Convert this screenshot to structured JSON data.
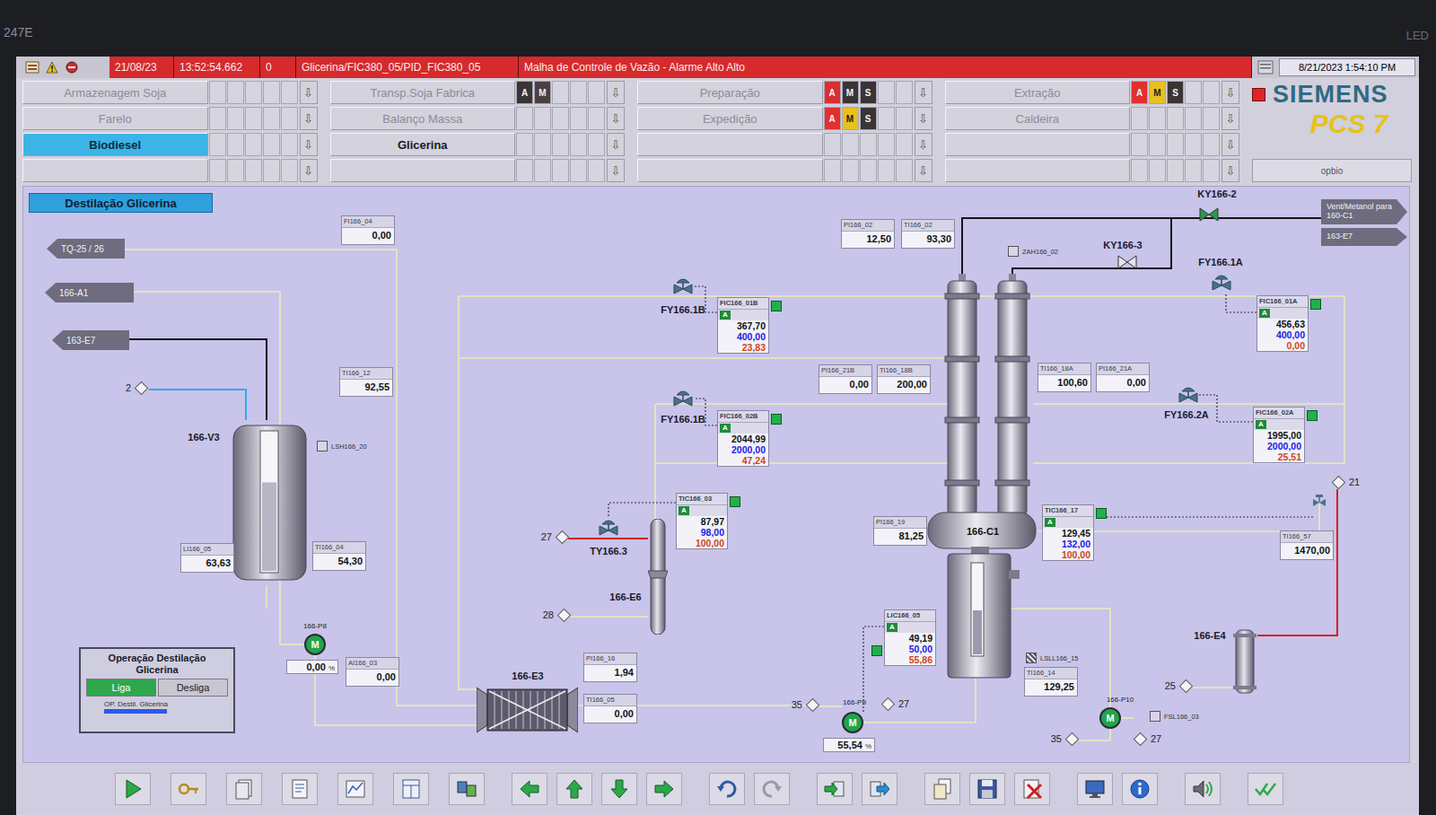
{
  "bezel": {
    "left_label": "247E",
    "right_label": "LED"
  },
  "alarm": {
    "date": "21/08/23",
    "time": "13:52:54.662",
    "count": "0",
    "source": "Glicerina/FIC380_05/PID_FIC380_05",
    "message": "Malha de Controle de Vazão - Alarme Alto Alto",
    "clock": "8/21/2023 1:54:10 PM"
  },
  "nav": {
    "arrow": "⇩",
    "rows": [
      [
        {
          "label": "Armazenagem Soja",
          "selected": false,
          "dimmed": true,
          "flags": []
        },
        {
          "label": "Transp.Soja Fabrica",
          "selected": false,
          "dimmed": true,
          "flags": [
            {
              "letter": "A",
              "color": "#3a3434"
            },
            {
              "letter": "M",
              "color": "#4a4040"
            }
          ]
        },
        {
          "label": "Preparação",
          "selected": false,
          "dimmed": true,
          "flags": [
            {
              "letter": "A",
              "color": "#d83030"
            },
            {
              "letter": "M",
              "color": "#3a3434"
            },
            {
              "letter": "S",
              "color": "#3a3434"
            }
          ]
        },
        {
          "label": "Extração",
          "selected": false,
          "dimmed": true,
          "flags": [
            {
              "letter": "A",
              "color": "#e03030"
            },
            {
              "letter": "M",
              "color": "#e8c020"
            },
            {
              "letter": "S",
              "color": "#3a3434"
            }
          ]
        }
      ],
      [
        {
          "label": "Farelo",
          "selected": false,
          "dimmed": true,
          "flags": []
        },
        {
          "label": "Balanço Massa",
          "selected": false,
          "dimmed": true,
          "flags": []
        },
        {
          "label": "Expedição",
          "selected": false,
          "dimmed": true,
          "flags": [
            {
              "letter": "A",
              "color": "#e03030"
            },
            {
              "letter": "M",
              "color": "#e8c020"
            },
            {
              "letter": "S",
              "color": "#3a3434"
            }
          ]
        },
        {
          "label": "Caldeira",
          "selected": false,
          "dimmed": true,
          "flags": []
        }
      ],
      [
        {
          "label": "Biodiesel",
          "selected": true,
          "dimmed": false,
          "flags": []
        },
        {
          "label": "Glicerina",
          "selected": false,
          "dimmed": false,
          "flags": []
        },
        {
          "label": "",
          "selected": false,
          "dimmed": false,
          "flags": []
        },
        {
          "label": "",
          "selected": false,
          "dimmed": false,
          "flags": []
        }
      ],
      [
        {
          "label": "",
          "selected": false,
          "dimmed": false,
          "flags": []
        },
        {
          "label": "",
          "selected": false,
          "dimmed": false,
          "flags": []
        },
        {
          "label": "",
          "selected": false,
          "dimmed": false,
          "flags": []
        },
        {
          "label": "",
          "selected": false,
          "dimmed": false,
          "flags": []
        }
      ]
    ]
  },
  "alarm_indicator": {
    "active": true,
    "color": "#e02424"
  },
  "logo": {
    "brand": "SIEMENS",
    "product": "PCS 7"
  },
  "user": "opbio",
  "diagram": {
    "title": "Destilação Glicerina",
    "connectors": [
      {
        "label": "TQ-25 / 26",
        "kind": "left"
      },
      {
        "label": "166-A1",
        "kind": "left"
      },
      {
        "label": "163-E7",
        "kind": "left"
      },
      {
        "label": "Vent/Metanol para 160-C1",
        "kind": "right"
      },
      {
        "label": "163-E7",
        "kind": "right"
      }
    ],
    "indicators": [
      {
        "tag": "FI166_04",
        "value": "0,00"
      },
      {
        "tag": "TI166_12",
        "value": "92,55"
      },
      {
        "tag": "LI166_05",
        "value": "63,63"
      },
      {
        "tag": "TI166_04",
        "value": "54,30"
      },
      {
        "tag": "AI166_03",
        "value": "0,00"
      },
      {
        "tag": "PI166_16",
        "value": "1,94"
      },
      {
        "tag": "TI166_05",
        "value": "0,00"
      },
      {
        "tag": "PI166_21B",
        "value": "0,00"
      },
      {
        "tag": "TI166_18B",
        "value": "200,00"
      },
      {
        "tag": "PI166_02",
        "value": "12,50"
      },
      {
        "tag": "TI166_02",
        "value": "93,30"
      },
      {
        "tag": "TI166_18A",
        "value": "100,60"
      },
      {
        "tag": "PI166_21A",
        "value": "0,00"
      },
      {
        "tag": "PI166_19",
        "value": "81,25"
      },
      {
        "tag": "TI166_57",
        "value": "1470,00"
      },
      {
        "tag": "TI166_14",
        "value": "129,25"
      }
    ],
    "controllers": [
      {
        "tag": "FIC166_01B",
        "mode": "A",
        "pv": "367,70",
        "sp": "400,00",
        "out": "23,83",
        "ok": true
      },
      {
        "tag": "FIC166_02B",
        "mode": "A",
        "pv": "2044,99",
        "sp": "2000,00",
        "out": "47,24",
        "ok": true
      },
      {
        "tag": "TIC166_03",
        "mode": "A",
        "pv": "87,97",
        "sp": "98,00",
        "out": "100,00",
        "ok": true
      },
      {
        "tag": "TIC166_17",
        "mode": "A",
        "pv": "129,45",
        "sp": "132,00",
        "out": "100,00",
        "ok": true
      },
      {
        "tag": "LIC166_05",
        "mode": "A",
        "pv": "49,19",
        "sp": "50,00",
        "out": "55,86",
        "ok": true
      },
      {
        "tag": "FIC166_01A",
        "mode": "A",
        "pv": "456,63",
        "sp": "400,00",
        "out": "0,00",
        "ok": true
      },
      {
        "tag": "FIC166_02A",
        "mode": "A",
        "pv": "1995,00",
        "sp": "2000,00",
        "out": "25,51",
        "ok": true
      }
    ],
    "valves": [
      {
        "tag": "FY166.1B",
        "kind": "control"
      },
      {
        "tag": "FY166.1B",
        "kind": "control"
      },
      {
        "tag": "TY166.3",
        "kind": "control"
      },
      {
        "tag": "FY166.1A",
        "kind": "control"
      },
      {
        "tag": "FY166.2A",
        "kind": "control"
      },
      {
        "tag": "KY166-2",
        "kind": "open"
      },
      {
        "tag": "KY166-3",
        "kind": "closed"
      }
    ],
    "equipment": [
      {
        "tag": "166-V3",
        "kind": "tank",
        "level": 0.64
      },
      {
        "tag": "166-E6",
        "kind": "shell"
      },
      {
        "tag": "166-E3",
        "kind": "plate"
      },
      {
        "tag": "166-C1",
        "kind": "column",
        "level": 0.49
      },
      {
        "tag": "166-E4",
        "kind": "cooler"
      }
    ],
    "pumps": [
      {
        "tag": "166-P8",
        "glyph": "M",
        "running": true
      },
      {
        "tag": "166-P9",
        "glyph": "M",
        "running": true
      },
      {
        "tag": "166-P10",
        "glyph": "M",
        "running": true
      }
    ],
    "points": [
      {
        "label": "2"
      },
      {
        "label": "27"
      },
      {
        "label": "28"
      },
      {
        "label": "35"
      },
      {
        "label": "27"
      },
      {
        "label": "35"
      },
      {
        "label": "27"
      },
      {
        "label": "25"
      },
      {
        "label": "21"
      }
    ],
    "switches": [
      {
        "tag": "LSH166_20",
        "active": false
      },
      {
        "tag": "ZAH166_02",
        "active": false
      },
      {
        "tag": "LSLL166_15",
        "active": true
      },
      {
        "tag": "FSL166_03",
        "active": false
      }
    ],
    "readouts": [
      {
        "value": "55,54",
        "unit": "%"
      },
      {
        "value": "0,00",
        "unit": "%"
      }
    ],
    "operation": {
      "title": "Operação Destilação Glicerina",
      "buttons": [
        {
          "label": "Liga",
          "selected": true
        },
        {
          "label": "Desliga",
          "selected": false
        }
      ],
      "status": {
        "label": "OP. Destil. Glicerina",
        "running": true
      }
    }
  }
}
